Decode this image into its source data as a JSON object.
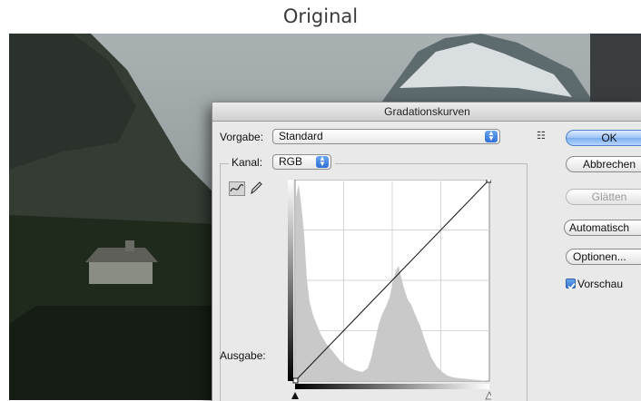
{
  "page": {
    "title": "Original"
  },
  "dialog": {
    "title": "Gradationskurven",
    "preset": {
      "label": "Vorgabe:",
      "value": "Standard"
    },
    "channel": {
      "label": "Kanal:",
      "value": "RGB"
    },
    "output_label": "Ausgabe:",
    "buttons": {
      "ok": "OK",
      "cancel": "Abbrechen",
      "smooth": "Glätten",
      "auto": "Automatisch",
      "options": "Optionen..."
    },
    "preview": {
      "label": "Vorschau",
      "checked": true
    }
  },
  "icons": [
    "presets-menu-icon",
    "curve-tool-icon",
    "pencil-icon",
    "checkmark-icon",
    "black-point-slider-icon",
    "white-point-slider-icon"
  ],
  "colors": {
    "ok_blue": "#7aaeef",
    "dialog_bg": "#e9e9e9",
    "histogram": "#c9c9c9"
  }
}
